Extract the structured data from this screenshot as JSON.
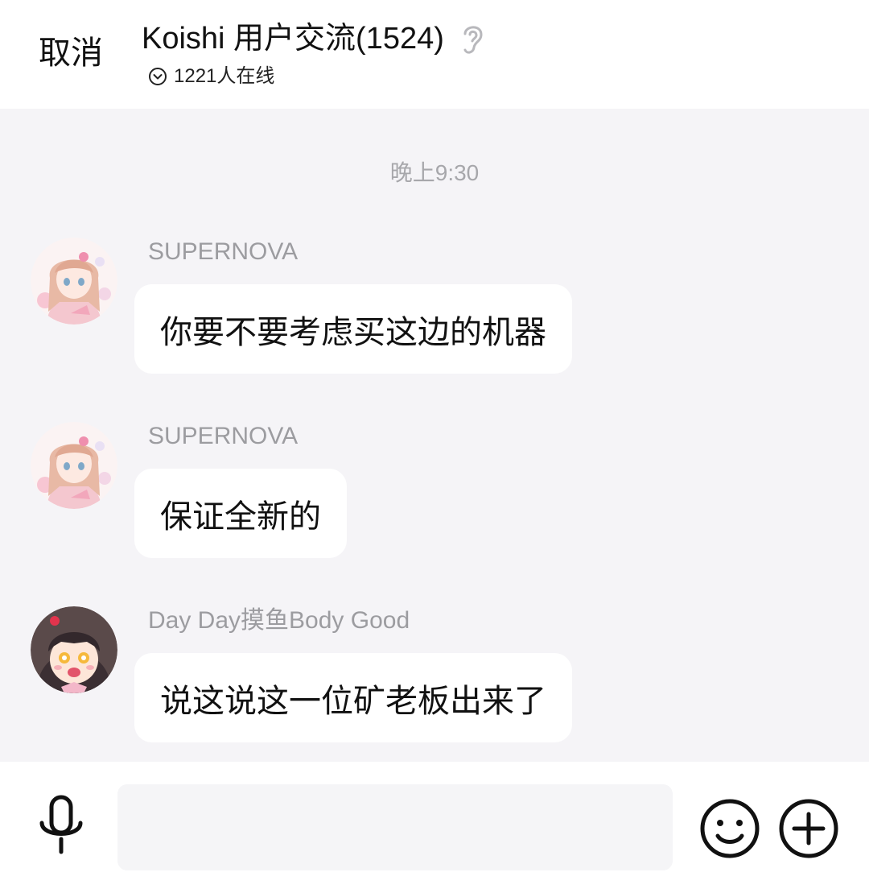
{
  "header": {
    "cancel_label": "取消",
    "group_title": "Koishi 用户交流(1524)",
    "online_text": "1221人在线",
    "ear_icon": "ear-icon",
    "dropdown_icon": "chevron-down-circle-icon"
  },
  "chat": {
    "timestamp": "晚上9:30",
    "messages": [
      {
        "sender": "SUPERNOVA",
        "text": "你要不要考虑买这边的机器",
        "avatar": "anime-girl-pink-avatar"
      },
      {
        "sender": "SUPERNOVA",
        "text": "保证全新的",
        "avatar": "anime-girl-pink-avatar"
      },
      {
        "sender": "Day Day摸鱼Body Good",
        "text": "说这说这一位矿老板出来了",
        "avatar": "anime-girl-dark-hair-avatar"
      }
    ]
  },
  "input_bar": {
    "placeholder": "",
    "mic_icon": "microphone-icon",
    "emoji_icon": "smiley-icon",
    "plus_icon": "plus-circle-icon"
  },
  "colors": {
    "chat_background": "#f5f4f7",
    "bubble_background": "#ffffff",
    "sender_text": "#9c9ca0",
    "timestamp_text": "#a7a7ab"
  }
}
